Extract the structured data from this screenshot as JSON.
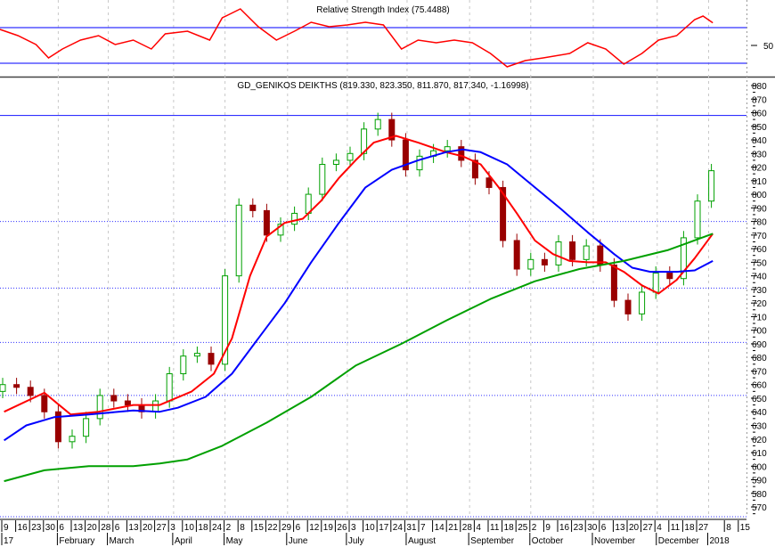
{
  "chart_data": [
    {
      "type": "line",
      "title": "Relative Strength Index (75.4488)",
      "ylabel_ticks": [
        "50"
      ],
      "levels": [
        70,
        30
      ],
      "ylim": [
        15,
        101
      ],
      "series": [
        {
          "name": "RSI",
          "color": "#ff0000",
          "points": [
            [
              -0.2,
              68
            ],
            [
              1.1,
              61
            ],
            [
              2.4,
              51
            ],
            [
              3.3,
              36
            ],
            [
              4.3,
              46
            ],
            [
              5.6,
              56
            ],
            [
              6.9,
              61
            ],
            [
              8.1,
              51
            ],
            [
              9.4,
              56
            ],
            [
              10.7,
              46
            ],
            [
              11.7,
              63
            ],
            [
              13.3,
              66
            ],
            [
              14.9,
              56
            ],
            [
              15.8,
              81
            ],
            [
              17.1,
              91
            ],
            [
              18.4,
              71
            ],
            [
              19.7,
              56
            ],
            [
              21,
              66
            ],
            [
              22.2,
              76
            ],
            [
              23.5,
              71
            ],
            [
              24.8,
              73
            ],
            [
              26.1,
              76
            ],
            [
              27.4,
              73
            ],
            [
              28.7,
              46
            ],
            [
              29.9,
              56
            ],
            [
              31.2,
              53
            ],
            [
              32.5,
              56
            ],
            [
              33.8,
              53
            ],
            [
              35.1,
              41
            ],
            [
              36.3,
              26
            ],
            [
              37.6,
              33
            ],
            [
              38.9,
              36
            ],
            [
              40.8,
              41
            ],
            [
              42.1,
              53
            ],
            [
              43.4,
              46
            ],
            [
              44.7,
              29
            ],
            [
              46,
              41
            ],
            [
              47.2,
              56
            ],
            [
              48.5,
              61
            ],
            [
              49.8,
              79
            ],
            [
              50.4,
              83
            ],
            [
              51.1,
              75.4488
            ]
          ]
        }
      ]
    },
    {
      "type": "candlestick",
      "title": "GD_GENIKOS DEIKTHS (819.330, 823.350, 811.870, 817.340, -1.16998)",
      "ylim": [
        560,
        885
      ],
      "yticks": [
        880,
        870,
        860,
        850,
        840,
        830,
        820,
        810,
        800,
        790,
        780,
        770,
        760,
        750,
        740,
        730,
        720,
        710,
        700,
        690,
        680,
        670,
        660,
        650,
        640,
        630,
        620,
        610,
        600,
        590,
        580,
        570
      ],
      "levels_solid": [
        858
      ],
      "levels_dotted": [
        780,
        731,
        691,
        652
      ],
      "x_unit": "week index (0 = Jan 9, 2017)",
      "x_ticks": [
        [
          "9",
          0
        ],
        [
          "16",
          1
        ],
        [
          "23",
          2
        ],
        [
          "30",
          3
        ],
        [
          "6",
          4
        ],
        [
          "13",
          5
        ],
        [
          "20",
          6
        ],
        [
          "28",
          7
        ],
        [
          "6",
          8
        ],
        [
          "13",
          9
        ],
        [
          "20",
          10
        ],
        [
          "27",
          11
        ],
        [
          "3",
          12
        ],
        [
          "10",
          13
        ],
        [
          "18",
          14
        ],
        [
          "24",
          15
        ],
        [
          "2",
          16
        ],
        [
          "8",
          17
        ],
        [
          "15",
          18
        ],
        [
          "22",
          19
        ],
        [
          "29",
          20
        ],
        [
          "6",
          21
        ],
        [
          "12",
          22
        ],
        [
          "19",
          23
        ],
        [
          "26",
          24
        ],
        [
          "3",
          25
        ],
        [
          "10",
          26
        ],
        [
          "17",
          27
        ],
        [
          "24",
          28
        ],
        [
          "31",
          29
        ],
        [
          "7",
          30
        ],
        [
          "14",
          31
        ],
        [
          "21",
          32
        ],
        [
          "28",
          33
        ],
        [
          "4",
          34
        ],
        [
          "11",
          35
        ],
        [
          "18",
          36
        ],
        [
          "25",
          37
        ],
        [
          "2",
          38
        ],
        [
          "9",
          39
        ],
        [
          "16",
          40
        ],
        [
          "23",
          41
        ],
        [
          "30",
          42
        ],
        [
          "6",
          43
        ],
        [
          "13",
          44
        ],
        [
          "20",
          45
        ],
        [
          "27",
          46
        ],
        [
          "4",
          47
        ],
        [
          "11",
          48
        ],
        [
          "18",
          49
        ],
        [
          "27",
          50
        ],
        [
          "8",
          52
        ],
        [
          "15",
          53
        ]
      ],
      "x_months": [
        [
          "17",
          0
        ],
        [
          "February",
          4
        ],
        [
          "March",
          7.6
        ],
        [
          "April",
          12.3
        ],
        [
          "May",
          16
        ],
        [
          "June",
          20.5
        ],
        [
          "July",
          24.8
        ],
        [
          "August",
          29.1
        ],
        [
          "September",
          33.6
        ],
        [
          "October",
          38
        ],
        [
          "November",
          42.5
        ],
        [
          "December",
          47.1
        ],
        [
          "2018",
          50.8
        ]
      ],
      "close": [
        660,
        658,
        652,
        640,
        618,
        622,
        635,
        652,
        648,
        645,
        640,
        648,
        668,
        681,
        683,
        675,
        740,
        792,
        788,
        770,
        778,
        786,
        800,
        822,
        825,
        830,
        848,
        855,
        840,
        818,
        828,
        832,
        835,
        825,
        812,
        805,
        766,
        745,
        752,
        748,
        765,
        752,
        762,
        748,
        722,
        712,
        728,
        742,
        738,
        768,
        795,
        817.34
      ],
      "first_open": 655,
      "up_color": "#00a000",
      "down_color": "#990000",
      "series": [
        {
          "name": "MA short",
          "color": "#ff0000",
          "points": [
            [
              0.1,
              640
            ],
            [
              3,
              654
            ],
            [
              4.9,
              638
            ],
            [
              6.9,
              640
            ],
            [
              9.4,
              645
            ],
            [
              11.3,
              645
            ],
            [
              13.6,
              655
            ],
            [
              15.2,
              668
            ],
            [
              16.5,
              694
            ],
            [
              17.8,
              740
            ],
            [
              19,
              769
            ],
            [
              20.3,
              779
            ],
            [
              21.6,
              782
            ],
            [
              22.9,
              795
            ],
            [
              24.2,
              812
            ],
            [
              25.4,
              825
            ],
            [
              26.7,
              838
            ],
            [
              28.3,
              843
            ],
            [
              29.9,
              838
            ],
            [
              31.9,
              831
            ],
            [
              33.1,
              828
            ],
            [
              34.4,
              822
            ],
            [
              35.7,
              805
            ],
            [
              37,
              786
            ],
            [
              38.3,
              766
            ],
            [
              39.6,
              756
            ],
            [
              40.8,
              751
            ],
            [
              42.1,
              750
            ],
            [
              43.4,
              750
            ],
            [
              44.7,
              743
            ],
            [
              46,
              733
            ],
            [
              47.2,
              727
            ],
            [
              48.5,
              737
            ],
            [
              49.8,
              753
            ],
            [
              51.1,
              771
            ]
          ]
        },
        {
          "name": "MA medium",
          "color": "#0000ff",
          "points": [
            [
              0.1,
              619
            ],
            [
              1.7,
              630
            ],
            [
              3.7,
              636
            ],
            [
              6.2,
              638
            ],
            [
              9.4,
              641
            ],
            [
              11.3,
              640
            ],
            [
              12.6,
              643
            ],
            [
              14.6,
              651
            ],
            [
              16.5,
              668
            ],
            [
              18.4,
              694
            ],
            [
              20.3,
              720
            ],
            [
              22.2,
              750
            ],
            [
              24.2,
              779
            ],
            [
              26.1,
              805
            ],
            [
              28,
              818
            ],
            [
              29.9,
              825
            ],
            [
              31.9,
              831
            ],
            [
              33.1,
              833
            ],
            [
              34.4,
              831
            ],
            [
              36.3,
              822
            ],
            [
              38.3,
              805
            ],
            [
              40.2,
              789
            ],
            [
              42.1,
              772
            ],
            [
              44,
              756
            ],
            [
              45.3,
              746
            ],
            [
              46.6,
              743
            ],
            [
              48.5,
              743
            ],
            [
              49.8,
              744
            ],
            [
              51.1,
              751
            ]
          ]
        },
        {
          "name": "MA long",
          "color": "#00a000",
          "points": [
            [
              0.1,
              589
            ],
            [
              3,
              597
            ],
            [
              6.2,
              600
            ],
            [
              9.4,
              600
            ],
            [
              11.3,
              602
            ],
            [
              13.3,
              605
            ],
            [
              15.8,
              615
            ],
            [
              19,
              632
            ],
            [
              22.2,
              651
            ],
            [
              25.4,
              674
            ],
            [
              28.7,
              690
            ],
            [
              31.9,
              707
            ],
            [
              35.1,
              723
            ],
            [
              38.3,
              736
            ],
            [
              41.5,
              745
            ],
            [
              44.7,
              751
            ],
            [
              47.9,
              759
            ],
            [
              51.1,
              771
            ]
          ]
        }
      ]
    }
  ]
}
